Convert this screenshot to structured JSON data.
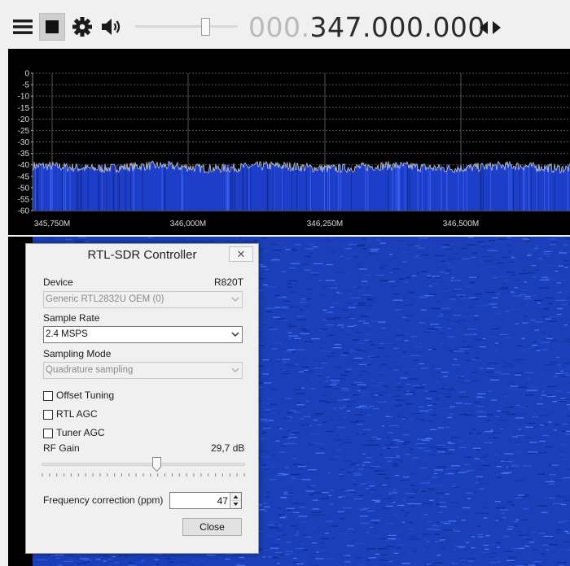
{
  "toolbar": {
    "frequency_dim": "000.",
    "frequency_main": "347.000.000",
    "volume_level": 0.68,
    "icons": [
      "menu-icon",
      "stop-icon",
      "gear-icon",
      "speaker-icon",
      "tune-arrows-icon"
    ]
  },
  "spectrum": {
    "y_ticks": [
      "0",
      "-5",
      "-10",
      "-15",
      "-20",
      "-25",
      "-30",
      "-35",
      "-40",
      "-45",
      "-50",
      "-55",
      "-60"
    ],
    "x_ticks": [
      "345,750M",
      "346,000M",
      "346,250M",
      "346,500M"
    ],
    "noise_floor_db": -41,
    "colors": {
      "background": "#000000",
      "fill": "#1d3ec9",
      "trace": "#c8c8c8",
      "grid": "#555555"
    }
  },
  "waterfall": {
    "colors": {
      "base": "#1b3fb8",
      "speckle": "#3d6cf0"
    }
  },
  "dialog": {
    "title": "RTL-SDR Controller",
    "close_glyph": "✕",
    "device_label": "Device",
    "device_tuner": "R820T",
    "device_value": "Generic RTL2832U OEM (0)",
    "sample_rate_label": "Sample Rate",
    "sample_rate_value": "2.4 MSPS",
    "sampling_mode_label": "Sampling Mode",
    "sampling_mode_value": "Quadrature sampling",
    "offset_tuning_label": "Offset Tuning",
    "rtl_agc_label": "RTL AGC",
    "tuner_agc_label": "Tuner AGC",
    "rf_gain_label": "RF Gain",
    "rf_gain_value": "29,7 dB",
    "freq_correction_label": "Frequency correction (ppm)",
    "freq_correction_value": "47",
    "close_label": "Close"
  }
}
